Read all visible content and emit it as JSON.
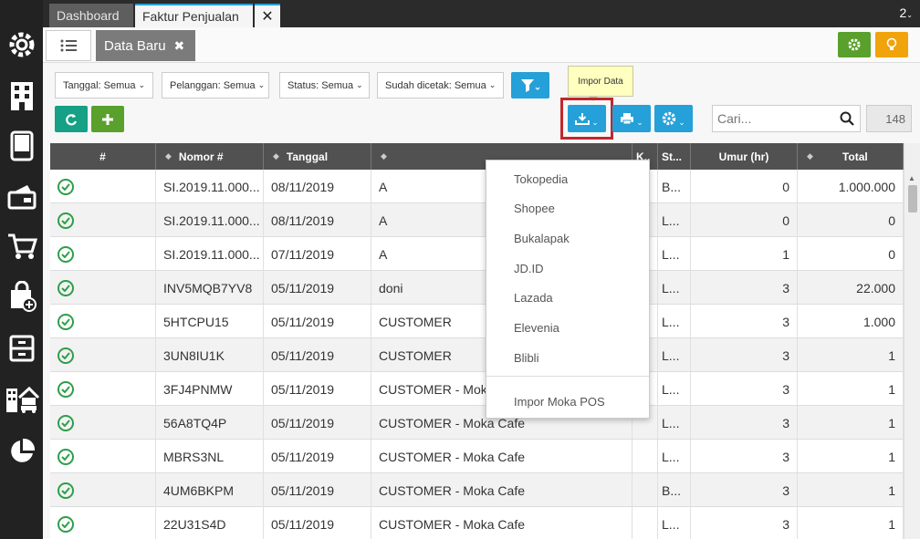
{
  "tabs": {
    "dashboard": "Dashboard",
    "faktur": "Faktur Penjualan",
    "close": "✕",
    "count": "2"
  },
  "toolbar": {
    "data_baru": "Data Baru",
    "data_baru_close": "✖"
  },
  "filters": {
    "tanggal": "Tanggal: Semua",
    "pelanggan": "Pelanggan: Semua",
    "status": "Status: Semua",
    "dicetak": "Sudah dicetak: Semua"
  },
  "tooltip": "Impor Data",
  "search": {
    "placeholder": "Cari..."
  },
  "record_count": "148",
  "table": {
    "headers": [
      "#",
      "Nomor #",
      "Tanggal",
      "",
      "K..",
      "St...",
      "Umur (hr)",
      "Total"
    ],
    "rows": [
      {
        "nomor": "SI.2019.11.000...",
        "tanggal": "08/11/2019",
        "pelanggan": "A",
        "status": "B...",
        "umur": "0",
        "total": "1.000.000"
      },
      {
        "nomor": "SI.2019.11.000...",
        "tanggal": "08/11/2019",
        "pelanggan": "A",
        "status": "L...",
        "umur": "0",
        "total": "0"
      },
      {
        "nomor": "SI.2019.11.000...",
        "tanggal": "07/11/2019",
        "pelanggan": "A",
        "status": "L...",
        "umur": "1",
        "total": "0"
      },
      {
        "nomor": "INV5MQB7YV8",
        "tanggal": "05/11/2019",
        "pelanggan": "doni",
        "status": "L...",
        "umur": "3",
        "total": "22.000"
      },
      {
        "nomor": "5HTCPU15",
        "tanggal": "05/11/2019",
        "pelanggan": "CUSTOMER",
        "status": "L...",
        "umur": "3",
        "total": "1.000"
      },
      {
        "nomor": "3UN8IU1K",
        "tanggal": "05/11/2019",
        "pelanggan": "CUSTOMER",
        "status": "L...",
        "umur": "3",
        "total": "1"
      },
      {
        "nomor": "3FJ4PNMW",
        "tanggal": "05/11/2019",
        "pelanggan": "CUSTOMER - Moka Cafe",
        "status": "L...",
        "umur": "3",
        "total": "1"
      },
      {
        "nomor": "56A8TQ4P",
        "tanggal": "05/11/2019",
        "pelanggan": "CUSTOMER - Moka Cafe",
        "status": "L...",
        "umur": "3",
        "total": "1"
      },
      {
        "nomor": "MBRS3NL",
        "tanggal": "05/11/2019",
        "pelanggan": "CUSTOMER - Moka Cafe",
        "status": "L...",
        "umur": "3",
        "total": "1"
      },
      {
        "nomor": "4UM6BKPM",
        "tanggal": "05/11/2019",
        "pelanggan": "CUSTOMER - Moka Cafe",
        "status": "B...",
        "umur": "3",
        "total": "1"
      },
      {
        "nomor": "22U31S4D",
        "tanggal": "05/11/2019",
        "pelanggan": "CUSTOMER - Moka Cafe",
        "status": "L...",
        "umur": "3",
        "total": "1"
      }
    ]
  },
  "dropdown": {
    "items": [
      "Tokopedia",
      "Shopee",
      "Bukalapak",
      "JD.ID",
      "Lazada",
      "Elevenia",
      "Blibli"
    ],
    "moka": "Impor Moka POS"
  },
  "colors": {
    "accent_blue": "#25a0d8",
    "green": "#5aa02c",
    "orange": "#f0a30a",
    "teal": "#16a085",
    "highlight_red": "#c0272d"
  },
  "sidebar_icons": [
    "gear-icon",
    "building-icon",
    "book-icon",
    "wallet-icon",
    "cart-icon",
    "bag-add-icon",
    "archive-icon",
    "warehouse-icon",
    "pie-chart-icon"
  ]
}
